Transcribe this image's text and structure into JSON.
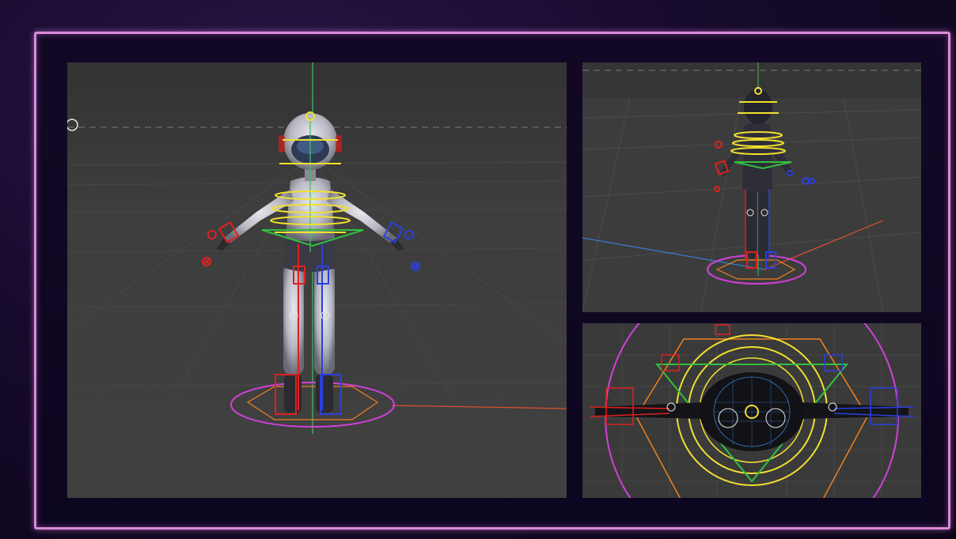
{
  "window": {
    "title": ""
  },
  "viewports": [
    {
      "id": "front",
      "label": "",
      "background": "#3d3d3d"
    },
    {
      "id": "perspective",
      "label": "",
      "background": "#3d3d3d"
    },
    {
      "id": "top",
      "label": "",
      "background": "#3a3a3a"
    }
  ],
  "colors": {
    "frame_border": "#d98ad8",
    "axis_x": "#e05030",
    "axis_y": "#40c060",
    "axis_z": "#3a7fd0",
    "rig_yellow": "#f0e030",
    "rig_green": "#30c040",
    "rig_red": "#e02020",
    "rig_blue": "#2a40e0",
    "root_magenta": "#d040d8",
    "root_orange": "#f08020"
  },
  "icons": {
    "viewport_gizmo": "circle-gizmo-icon"
  }
}
